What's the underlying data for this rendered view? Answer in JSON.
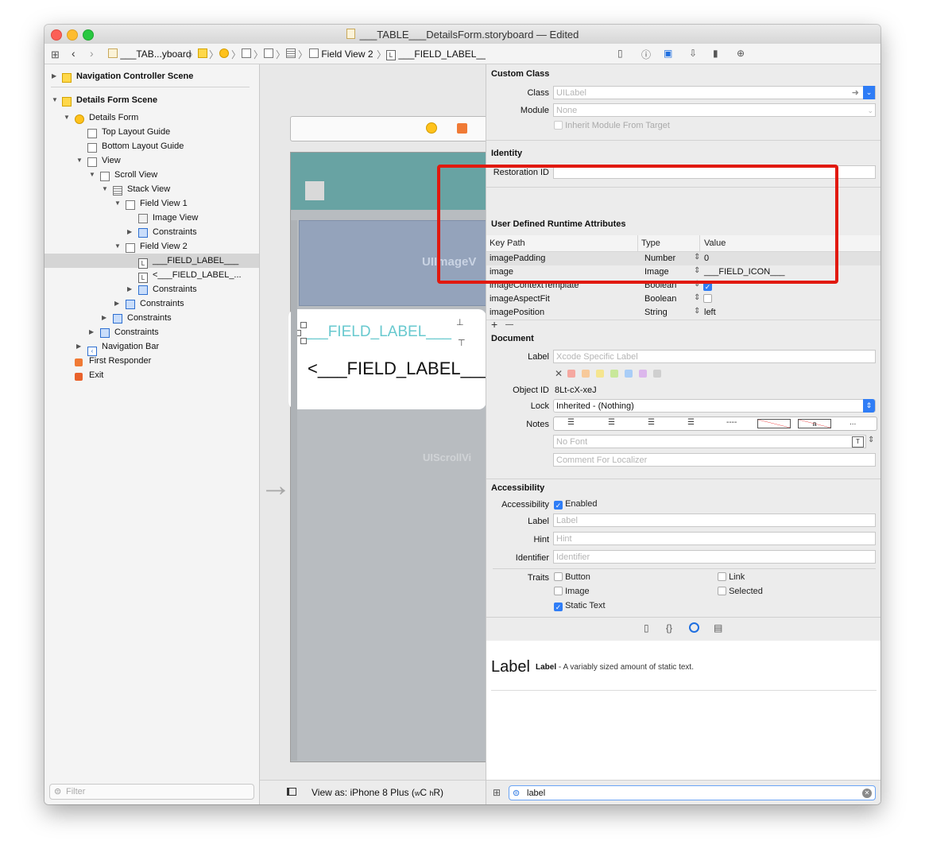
{
  "window": {
    "title": "___TABLE___DetailsForm.storyboard — Edited"
  },
  "jumpbar": {
    "items": [
      "___TAB...yboard",
      "Field View 2",
      "___FIELD_LABEL___"
    ]
  },
  "outline": {
    "rows": [
      {
        "label": "Navigation Controller Scene"
      },
      {
        "label": "Details Form Scene"
      },
      {
        "label": "Details Form"
      },
      {
        "label": "Top Layout Guide"
      },
      {
        "label": "Bottom Layout Guide"
      },
      {
        "label": "View"
      },
      {
        "label": "Scroll View"
      },
      {
        "label": "Stack View"
      },
      {
        "label": "Field View 1"
      },
      {
        "label": "Image View"
      },
      {
        "label": "Constraints"
      },
      {
        "label": "Field View 2"
      },
      {
        "label": "___FIELD_LABEL___"
      },
      {
        "label": "<___FIELD_LABEL_..."
      },
      {
        "label": "Constraints"
      },
      {
        "label": "Constraints"
      },
      {
        "label": "Constraints"
      },
      {
        "label": "Constraints"
      },
      {
        "label": "Navigation Bar"
      },
      {
        "label": "First Responder"
      },
      {
        "label": "Exit"
      }
    ],
    "filter_placeholder": "Filter"
  },
  "canvas": {
    "imageview_label": "UIImageV",
    "scrollview_label": "UIScrollVi",
    "field_label_1": "___FIELD_LABEL___",
    "field_label_2": "<___FIELD_LABEL___",
    "view_as": "View as: iPhone 8 Plus (",
    "view_as_w": "w",
    "view_as_c": "C",
    "view_as_h": "h",
    "view_as_r": "R)"
  },
  "inspector": {
    "custom_class": {
      "section": "Custom Class",
      "class_label": "Class",
      "class_placeholder": "UILabel",
      "module_label": "Module",
      "module_placeholder": "None",
      "inherit_label": "Inherit Module From Target"
    },
    "identity": {
      "section": "Identity",
      "restoration_label": "Restoration ID"
    },
    "udra": {
      "section": "User Defined Runtime Attributes",
      "col_key": "Key Path",
      "col_type": "Type",
      "col_value": "Value",
      "rows": [
        {
          "key": "imagePadding",
          "type": "Number",
          "value": "0"
        },
        {
          "key": "image",
          "type": "Image",
          "value": "___FIELD_ICON___"
        },
        {
          "key": "imageContextTemplate",
          "type": "Boolean",
          "value": ""
        },
        {
          "key": "imageAspectFit",
          "type": "Boolean",
          "value": ""
        },
        {
          "key": "imagePosition",
          "type": "String",
          "value": "left"
        }
      ],
      "add": "+",
      "remove": "—"
    },
    "document": {
      "section": "Document",
      "label_label": "Label",
      "label_placeholder": "Xcode Specific Label",
      "object_id_label": "Object ID",
      "object_id": "8Lt-cX-xeJ",
      "lock_label": "Lock",
      "lock_value": "Inherited - (Nothing)",
      "notes_label": "Notes",
      "font_placeholder": "No Font",
      "comment_placeholder": "Comment For Localizer",
      "notes_dash": "----",
      "notes_a": "a",
      "notes_more": "..."
    },
    "accessibility": {
      "section": "Accessibility",
      "accessibility_label": "Accessibility",
      "enabled_label": "Enabled",
      "label_label": "Label",
      "label_placeholder": "Label",
      "hint_label": "Hint",
      "hint_placeholder": "Hint",
      "identifier_label": "Identifier",
      "identifier_placeholder": "Identifier",
      "traits_label": "Traits",
      "traits": [
        "Button",
        "Link",
        "Image",
        "Selected",
        "Static Text"
      ]
    },
    "library": {
      "big_title": "Label",
      "bold_name": "Label",
      "description": " - A variably sized amount of static text.",
      "search_value": "label"
    }
  }
}
